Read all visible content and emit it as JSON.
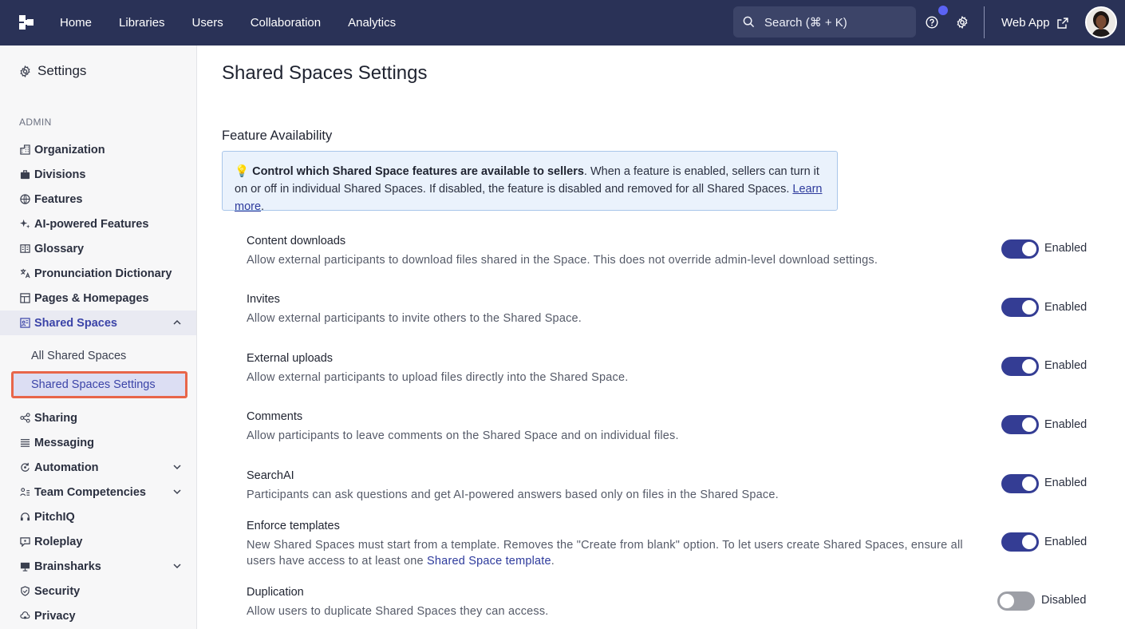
{
  "nav": {
    "items": [
      "Home",
      "Libraries",
      "Users",
      "Collaboration",
      "Analytics"
    ],
    "search_placeholder": "Search (⌘ + K)",
    "web_app": "Web App",
    "accent": "#2a3257",
    "icons": [
      "logo-icon",
      "search-icon",
      "help-icon",
      "gear-icon",
      "external-link-icon"
    ]
  },
  "sidebar": {
    "title": "Settings",
    "section": "ADMIN",
    "items": [
      {
        "label": "Organization",
        "icon": "building-icon"
      },
      {
        "label": "Divisions",
        "icon": "briefcase-icon"
      },
      {
        "label": "Features",
        "icon": "globe-icon"
      },
      {
        "label": "AI-powered Features",
        "icon": "sparkle-icon"
      },
      {
        "label": "Glossary",
        "icon": "book-icon"
      },
      {
        "label": "Pronunciation Dictionary",
        "icon": "translate-icon"
      },
      {
        "label": "Pages & Homepages",
        "icon": "layout-icon"
      },
      {
        "label": "Shared Spaces",
        "icon": "shared-space-icon",
        "expanded": true
      },
      {
        "label": "Sharing",
        "icon": "share-icon"
      },
      {
        "label": "Messaging",
        "icon": "list-icon"
      },
      {
        "label": "Automation",
        "icon": "automation-icon",
        "has_chevron": true
      },
      {
        "label": "Team Competencies",
        "icon": "team-icon",
        "has_chevron": true
      },
      {
        "label": "PitchIQ",
        "icon": "headset-icon"
      },
      {
        "label": "Roleplay",
        "icon": "chat-icon"
      },
      {
        "label": "Brainsharks",
        "icon": "presentation-icon",
        "has_chevron": true
      },
      {
        "label": "Security",
        "icon": "shield-icon"
      },
      {
        "label": "Privacy",
        "icon": "cloud-lock-icon"
      }
    ],
    "sub_items": [
      "All Shared Spaces",
      "Shared Spaces Settings"
    ],
    "selected_sub": "Shared Spaces Settings"
  },
  "main": {
    "title": "Shared Spaces Settings",
    "section_title": "Feature Availability",
    "info": {
      "emoji": "💡",
      "bold": "Control which Shared Space features are available to sellers",
      "text": ". When a feature is enabled, sellers can turn it on or off in individual Shared Spaces. If disabled, the feature is disabled and removed for all Shared Spaces. ",
      "link": "Learn more",
      "end": "."
    },
    "features": [
      {
        "name": "Content downloads",
        "desc": "Allow external participants to download files shared in the Space. This does not override admin-level download settings.",
        "status": "Enabled",
        "enabled": true
      },
      {
        "name": "Invites",
        "desc": "Allow external participants to invite others to the Shared Space.",
        "status": "Enabled",
        "enabled": true
      },
      {
        "name": "External uploads",
        "desc": "Allow external participants to upload files directly into the Shared Space.",
        "status": "Enabled",
        "enabled": true
      },
      {
        "name": "Comments",
        "desc": "Allow participants to leave comments on the Shared Space and on individual files.",
        "status": "Enabled",
        "enabled": true
      },
      {
        "name": "SearchAI",
        "desc": "Participants can ask questions and get AI-powered answers based only on files in the Shared Space.",
        "status": "Enabled",
        "enabled": true
      },
      {
        "name": "Enforce templates",
        "desc": "New Shared Spaces must start from a template. Removes the \"Create from blank\" option. To let users create Shared Spaces, ensure all users have access to at least one ",
        "desc_link": "Shared Space template",
        "desc_end": ".",
        "status": "Enabled",
        "enabled": true
      },
      {
        "name": "Duplication",
        "desc": "Allow users to duplicate Shared Spaces they can access.",
        "status": "Disabled",
        "enabled": false
      }
    ]
  }
}
